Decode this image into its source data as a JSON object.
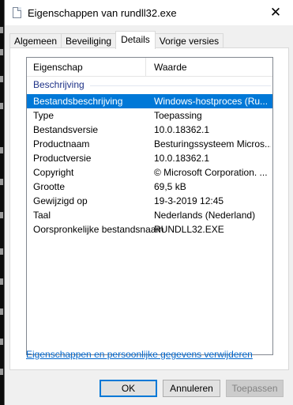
{
  "window": {
    "title": "Eigenschappen van rundll32.exe",
    "close_glyph": "✕"
  },
  "tabs": [
    {
      "label": "Algemeen",
      "active": false
    },
    {
      "label": "Beveiliging",
      "active": false
    },
    {
      "label": "Details",
      "active": true
    },
    {
      "label": "Vorige versies",
      "active": false
    }
  ],
  "details": {
    "columns": [
      "Eigenschap",
      "Waarde"
    ],
    "group_label": "Beschrijving",
    "rows": [
      {
        "property": "Bestandsbeschrijving",
        "value": "Windows-hostproces (Ru...",
        "selected": true
      },
      {
        "property": "Type",
        "value": "Toepassing",
        "selected": false
      },
      {
        "property": "Bestandsversie",
        "value": "10.0.18362.1",
        "selected": false
      },
      {
        "property": "Productnaam",
        "value": "Besturingssysteem Micros...",
        "selected": false
      },
      {
        "property": "Productversie",
        "value": "10.0.18362.1",
        "selected": false
      },
      {
        "property": "Copyright",
        "value": "© Microsoft Corporation. ...",
        "selected": false
      },
      {
        "property": "Grootte",
        "value": "69,5 kB",
        "selected": false
      },
      {
        "property": "Gewijzigd op",
        "value": "19-3-2019 12:45",
        "selected": false
      },
      {
        "property": "Taal",
        "value": "Nederlands (Nederland)",
        "selected": false
      },
      {
        "property": "Oorspronkelijke bestandsnaam",
        "value": "RUNDLL32.EXE",
        "selected": false
      }
    ]
  },
  "remove_link": "Eigenschappen en persoonlijke gegevens verwijderen",
  "buttons": {
    "ok": "OK",
    "cancel": "Annuleren",
    "apply": "Toepassen"
  },
  "colors": {
    "selection": "#0078d7",
    "link": "#0066cc",
    "group_label": "#1e3287"
  }
}
